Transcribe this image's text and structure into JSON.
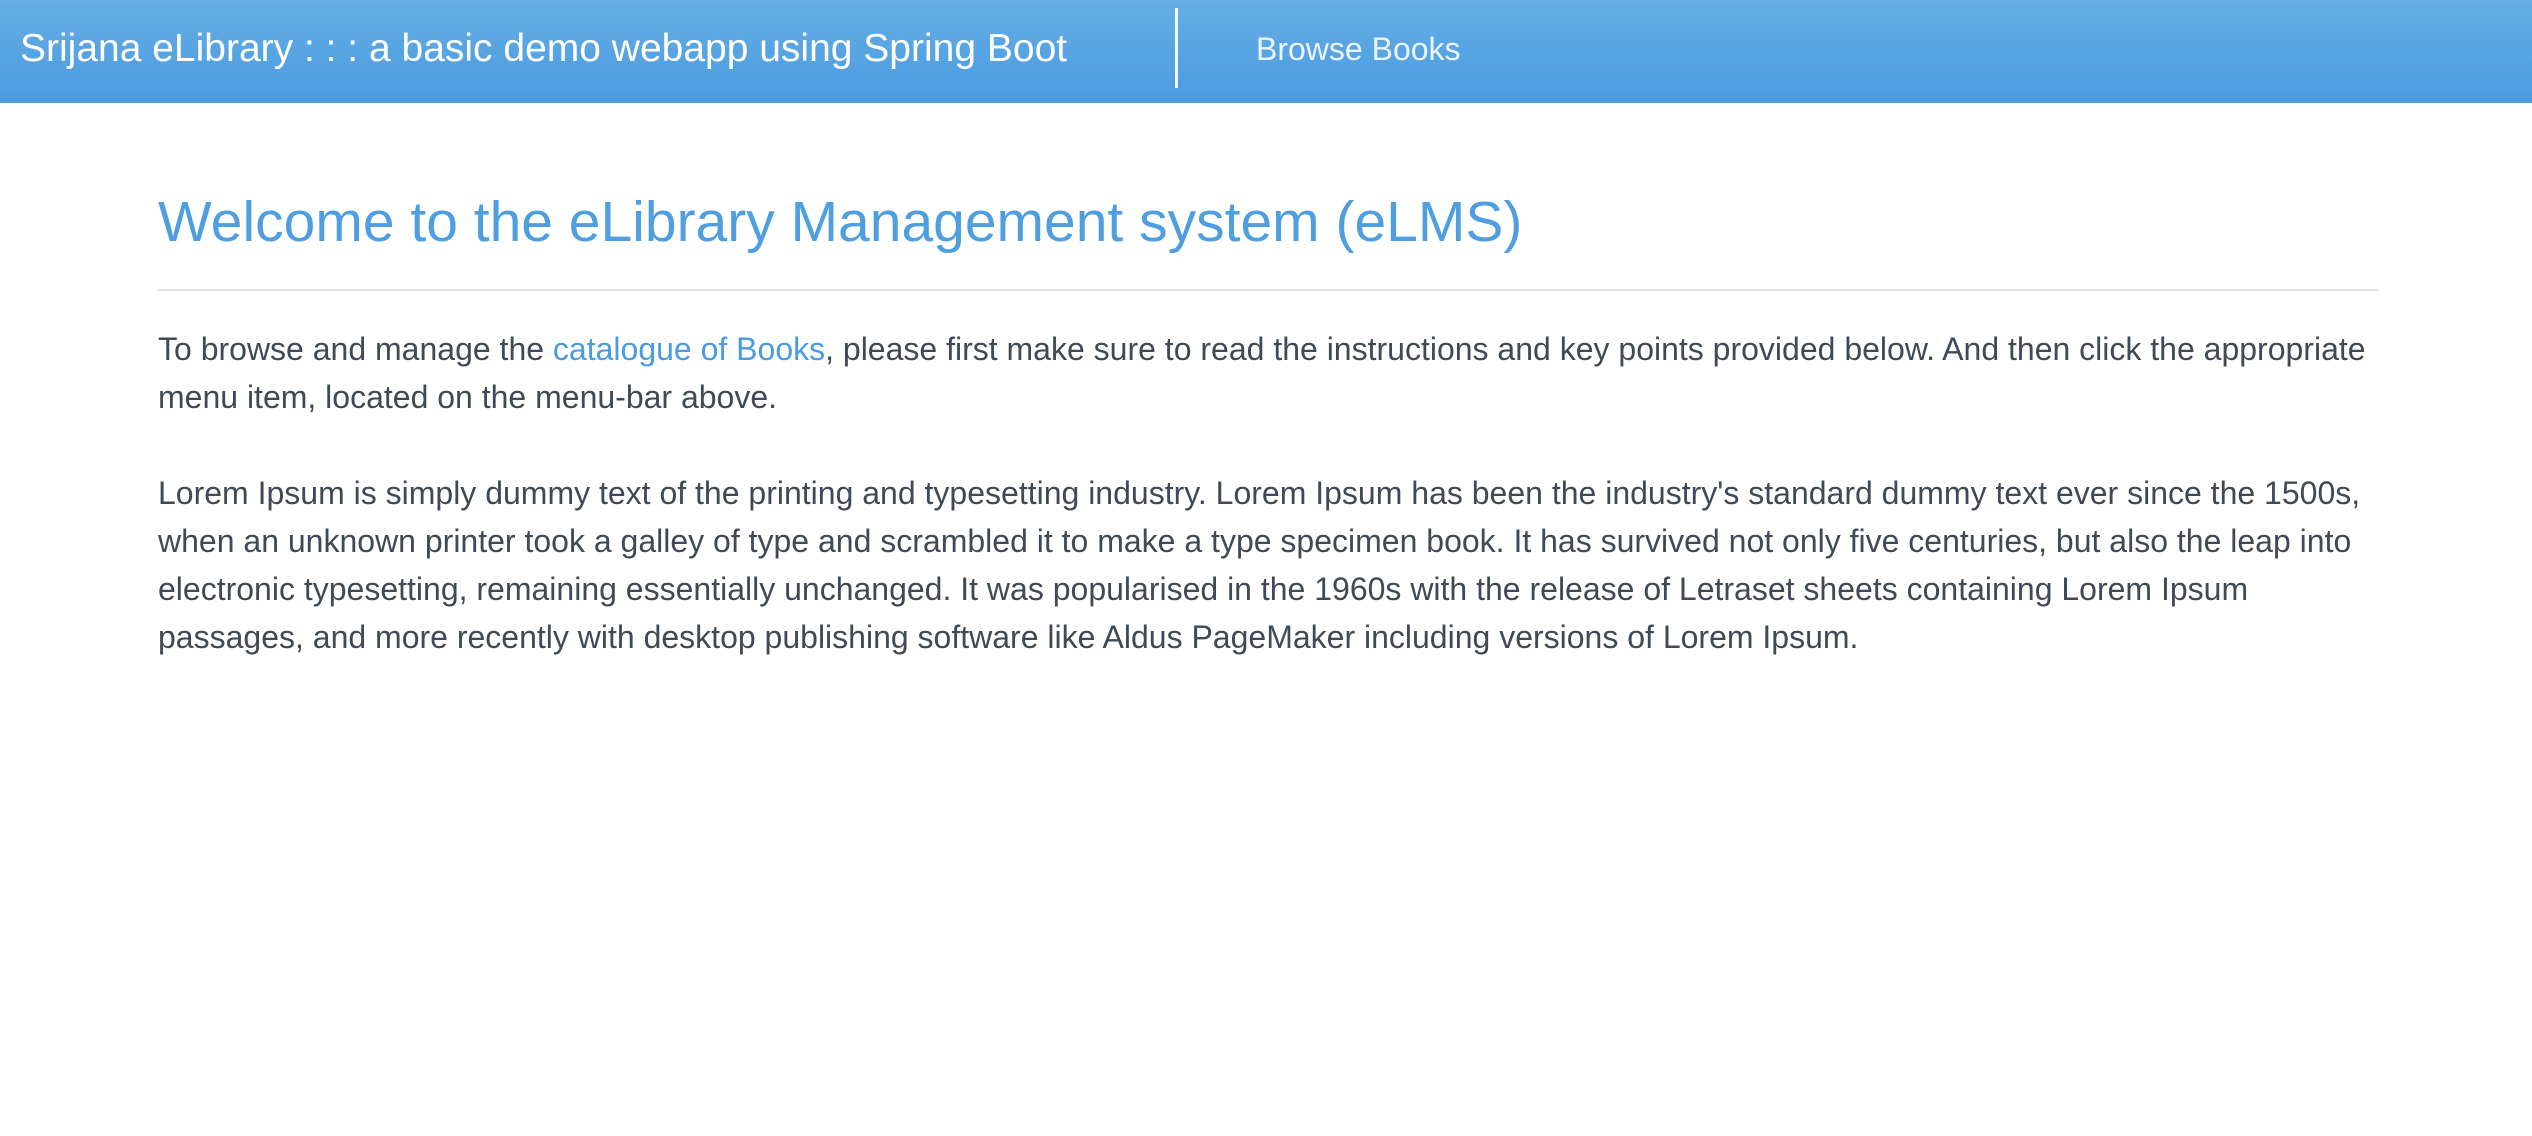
{
  "navbar": {
    "brand": "Srijana eLibrary : : : a basic demo webapp using Spring Boot",
    "links": [
      {
        "label": "Browse Books"
      }
    ]
  },
  "main": {
    "title": "Welcome to the eLibrary Management system (eLMS)",
    "intro": {
      "before_link": "To browse and manage the ",
      "link_text": "catalogue of Books",
      "after_link": ", please first make sure to read the instructions and key points provided below. And then click the appropriate menu item, located on the menu-bar above."
    },
    "lorem": "Lorem Ipsum is simply dummy text of the printing and typesetting industry. Lorem Ipsum has been the industry's standard dummy text ever since the 1500s, when an unknown printer took a galley of type and scrambled it to make a type specimen book. It has survived not only five centuries, but also the leap into electronic typesetting, remaining essentially unchanged. It was popularised in the 1960s with the release of Letraset sheets containing Lorem Ipsum passages, and more recently with desktop publishing software like Aldus PageMaker including versions of Lorem Ipsum."
  },
  "colors": {
    "navbar_top": "#66aee4",
    "navbar_bottom": "#4a9be0",
    "title": "#4f9fe0",
    "link": "#4a9be0",
    "body_text": "#3f4a56"
  }
}
